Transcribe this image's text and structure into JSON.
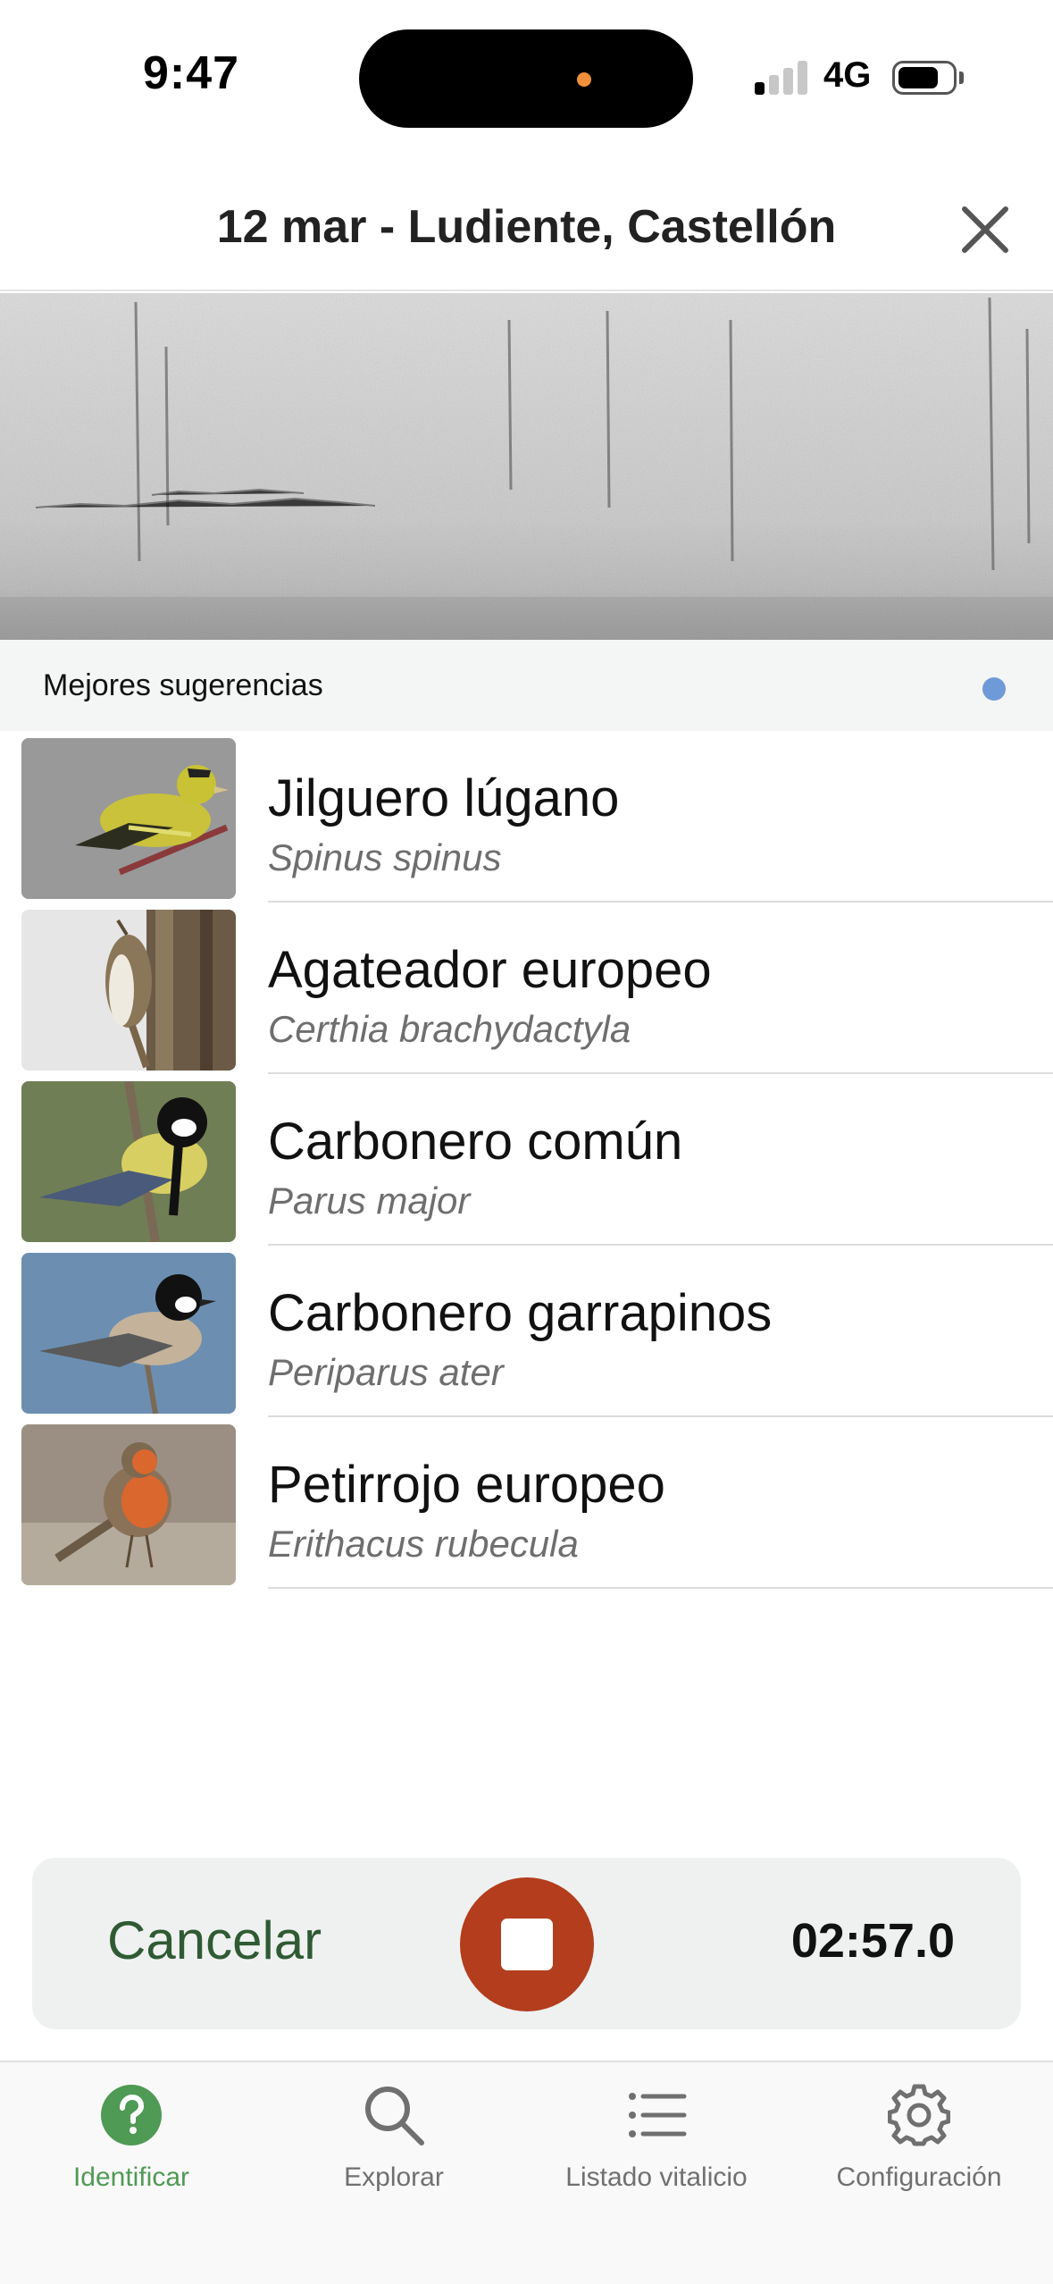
{
  "status_bar": {
    "time": "9:47",
    "network": "4G",
    "signal_bars_active": 1,
    "signal_bars_total": 4,
    "battery_level": 0.65
  },
  "header": {
    "title": "12 mar - Ludiente, Castellón",
    "close_icon": "close-icon"
  },
  "suggestions": {
    "title": "Mejores sugerencias",
    "indicator_color": "#6f9ad8",
    "items": [
      {
        "common_name": "Jilguero lúgano",
        "scientific_name": "Spinus spinus"
      },
      {
        "common_name": "Agateador europeo",
        "scientific_name": "Certhia brachydactyla"
      },
      {
        "common_name": "Carbonero común",
        "scientific_name": "Parus major"
      },
      {
        "common_name": "Carbonero garrapinos",
        "scientific_name": "Periparus ater"
      },
      {
        "common_name": "Petirrojo europeo",
        "scientific_name": "Erithacus rubecula"
      }
    ]
  },
  "recording": {
    "cancel_label": "Cancelar",
    "stop_icon": "stop-icon",
    "timer": "02:57.0",
    "stop_color": "#b33d1c"
  },
  "tabs": [
    {
      "label": "Identificar",
      "icon": "question-icon",
      "active": true
    },
    {
      "label": "Explorar",
      "icon": "search-icon",
      "active": false
    },
    {
      "label": "Listado vitalicio",
      "icon": "list-icon",
      "active": false
    },
    {
      "label": "Configuración",
      "icon": "gear-icon",
      "active": false
    }
  ],
  "colors": {
    "accent_green": "#4f9a55",
    "cancel_green": "#2f5a33"
  }
}
